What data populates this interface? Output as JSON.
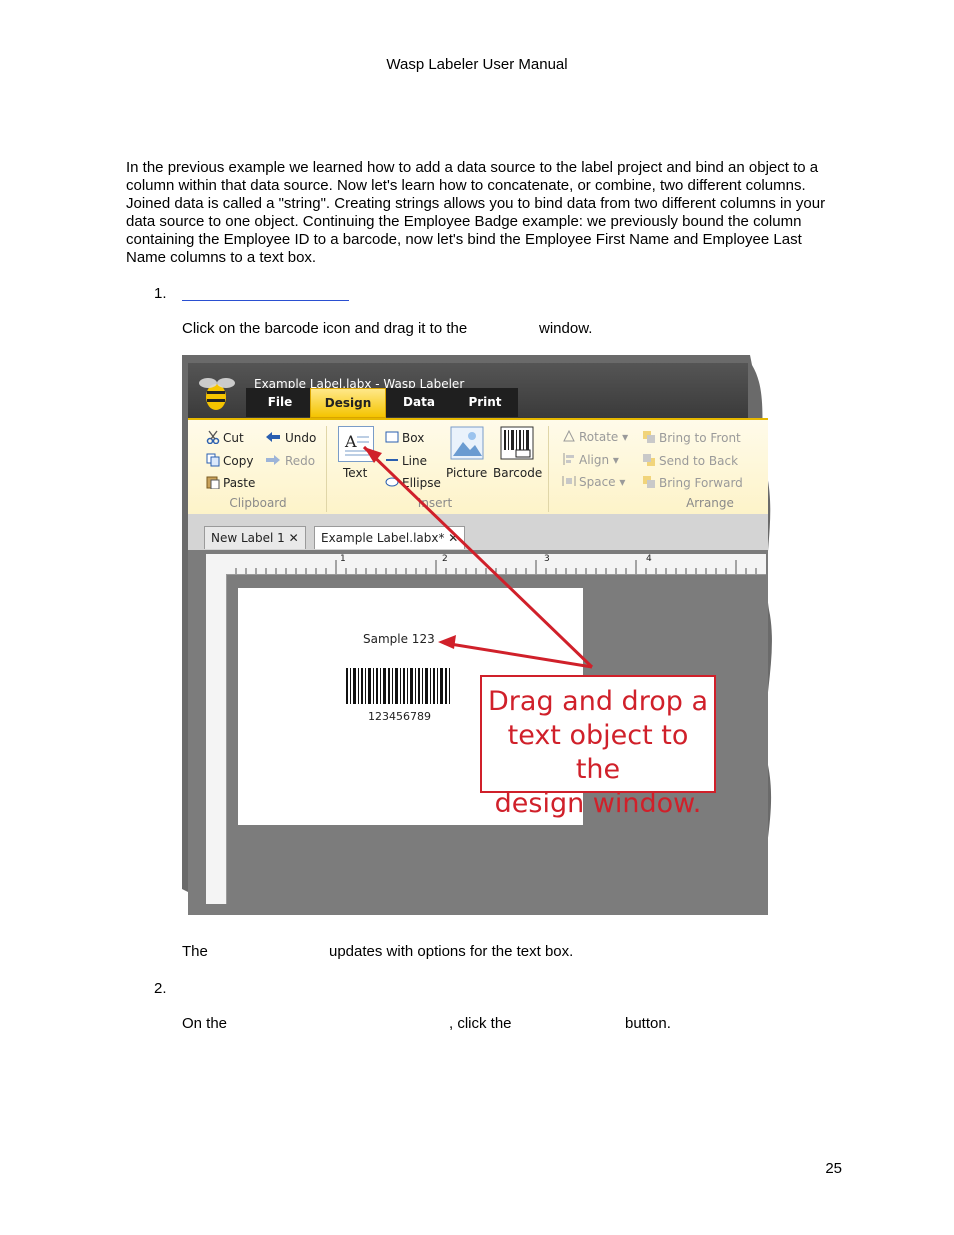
{
  "header": {
    "title": "Wasp Labeler User Manual"
  },
  "intro": "In the previous example we learned how to add a data source to the label project and bind an object to a column within that data source.  Now let's learn how to concatenate, or combine, two different columns. Joined data is called a \"string\".  Creating strings allows you to bind data from two different columns in your data source to one object.  Continuing the Employee Badge example: we previously bound the column containing the Employee ID to a barcode, now let's bind the Employee First Name and Employee Last Name columns to a text box.",
  "steps": [
    {
      "number": "1.",
      "text_a": "Click on the barcode icon and drag it to the",
      "text_b": "window."
    },
    {
      "number": "2.",
      "text_a": "On the",
      "text_b": ", click the",
      "text_c": "button."
    }
  ],
  "after_image": {
    "text_a": "The",
    "text_b": "updates with options for the text box."
  },
  "page_number": "25",
  "screenshot": {
    "window_title": "Example Label.labx - Wasp Labeler",
    "tabs": [
      "File",
      "Design",
      "Data",
      "Print"
    ],
    "selected_tab": "Design",
    "clipboard": {
      "cut": "Cut",
      "copy": "Copy",
      "paste": "Paste",
      "undo": "Undo",
      "redo": "Redo",
      "group": "Clipboard"
    },
    "insert": {
      "text": "Text",
      "box": "Box",
      "line": "Line",
      "ellipse": "Ellipse",
      "picture": "Picture",
      "barcode": "Barcode",
      "group": "Insert"
    },
    "arrange": {
      "rotate": "Rotate",
      "align": "Align",
      "space": "Space",
      "bring_front": "Bring to Front",
      "send_back": "Send to Back",
      "bring_forward": "Bring Forward",
      "group": "Arrange"
    },
    "doc_tabs": [
      "New Label 1",
      "Example Label.labx*"
    ],
    "ruler_marks": [
      "1",
      "2",
      "3",
      "4"
    ],
    "label_text": "Sample 123",
    "barcode_value": "123456789",
    "callout": [
      "Drag and drop a",
      "text object to the",
      "design window."
    ],
    "colors": {
      "accent": "#f5c400",
      "callout": "#d0202a",
      "link": "#2a4fd1"
    }
  }
}
